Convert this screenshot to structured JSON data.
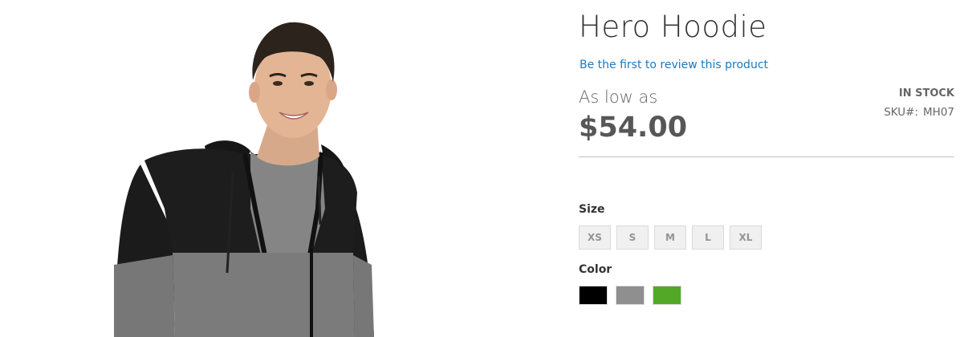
{
  "product": {
    "title": "Hero Hoodie",
    "review_link": "Be the first to review this product",
    "price_label": "As low as",
    "price": "$54.00",
    "stock_status": "In stock",
    "sku_label": "SKU#:",
    "sku_value": "MH07"
  },
  "options": {
    "size": {
      "label": "Size",
      "values": [
        "XS",
        "S",
        "M",
        "L",
        "XL"
      ]
    },
    "color": {
      "label": "Color",
      "swatches": [
        {
          "name": "Black",
          "hex": "#000000"
        },
        {
          "name": "Gray",
          "hex": "#8f8f8f"
        },
        {
          "name": "Green",
          "hex": "#53a927"
        }
      ]
    }
  },
  "colors": {
    "link": "#1979c3",
    "divider": "#c1c1c1"
  }
}
